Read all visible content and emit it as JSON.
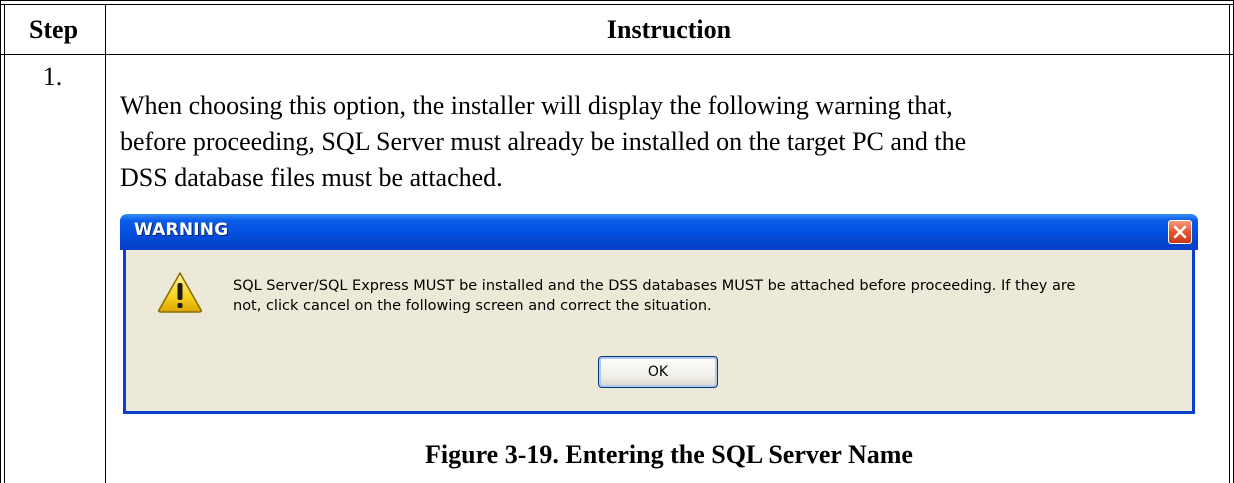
{
  "table": {
    "header_step": "Step",
    "header_instruction": "Instruction",
    "step_number": "1.",
    "instruction_lines": [
      "When choosing this option, the installer will display the following warning that,",
      "before proceeding, SQL Server must already be installed on the target PC and the",
      "DSS database files must be attached."
    ],
    "caption": "Figure 3-19.  Entering the SQL Server Name"
  },
  "dialog": {
    "title": "WARNING",
    "message_lines": [
      "SQL Server/SQL Express MUST be installed and the DSS databases MUST be attached before proceeding.  If they are",
      "not, click cancel on the following screen and correct the situation."
    ],
    "ok_label": "OK",
    "close_icon": "close-icon",
    "warning_icon": "warning-icon"
  }
}
